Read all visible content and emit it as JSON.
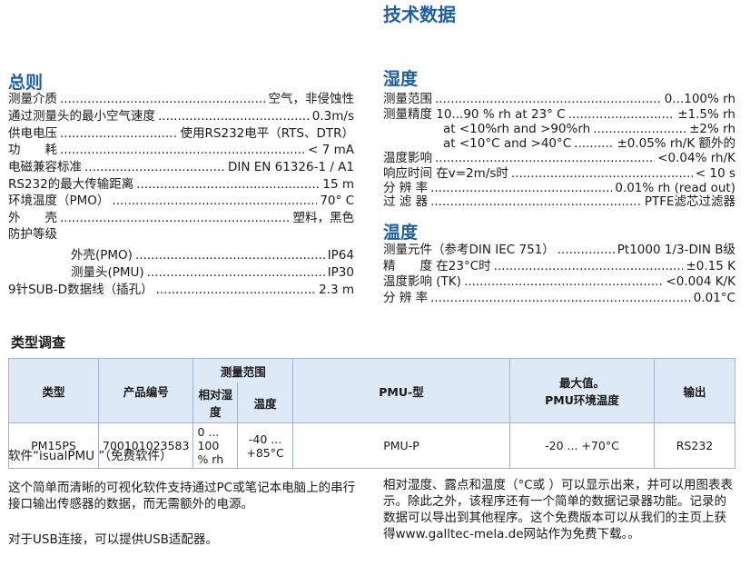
{
  "right_title": "技术数据",
  "left": {
    "heading": "总则",
    "rows": [
      {
        "label": "测量介质",
        "value": "空气，非侵蚀性"
      },
      {
        "label": "通过测量头的最小空气速度",
        "value": "0.3m/s"
      },
      {
        "label": "供电电压",
        "value": "使用RS232电平（RTS、DTR）"
      },
      {
        "label": "功　　耗",
        "value": "< 7 mA"
      },
      {
        "label": "电磁兼容标准",
        "value": "DIN EN 61326-1 / A1"
      },
      {
        "label": "RS232的最大传输距离",
        "value": "15 m"
      },
      {
        "label": "环境温度（PMO）",
        "value": "70° C"
      },
      {
        "label": "外　　壳",
        "value": "塑料，黑色"
      }
    ],
    "protection_title": "防护等级",
    "protection_rows": [
      {
        "label": "外壳(PMO)",
        "value": "IP64"
      },
      {
        "label": "测量头(PMU)",
        "value": "IP30"
      }
    ],
    "cable_row": {
      "label": "9针SUB-D数据线（插孔）",
      "value": "2.3 m"
    }
  },
  "right": {
    "humidity_heading": "湿度",
    "humidity_rows": [
      {
        "label": "测量范围",
        "value": "0...100% rh"
      },
      {
        "label": "测量精度  10...90 % rh at 23° C",
        "value": "±1.5% rh"
      },
      {
        "label": "at <10%rh and >90%rh",
        "value": "±2% rh"
      },
      {
        "label": "at <10°C and >40°C",
        "value": "±0.05% rh/K 额外的"
      },
      {
        "label": "温度影响",
        "value": "<0.04% rh/K"
      },
      {
        "label": "响应时间  在v=2m/s时",
        "value": "< 10 s"
      },
      {
        "label": "分 辨 率",
        "value": "0.01% rh (read out)"
      },
      {
        "label": "过 滤 器",
        "value": "PTFE滤芯过滤器"
      }
    ],
    "temp_heading": "温度",
    "temp_rows": [
      {
        "label": "测量元件（参考DIN IEC 751）",
        "value": "Pt1000 1/3-DIN B级"
      },
      {
        "label": "精　　度  在23°C时",
        "value": "±0.15 K"
      },
      {
        "label": "温度影响 (TK)",
        "value": "<0.004 K/K"
      },
      {
        "label": "分 辨 率",
        "value": "0.01°C"
      }
    ]
  },
  "types": {
    "title": "类型调查",
    "headers": {
      "type": "类型",
      "product_no": "产品编号",
      "range": "测量范围",
      "rh": "相对湿度",
      "temp": "温度",
      "pmu": "PMU-型",
      "max_top": "最大值。",
      "max_bottom": "PMU环境温度",
      "output": "输出"
    },
    "row": [
      "PM15PS",
      "700101023583",
      "0 ... 100 % rh",
      "-40 ... +85°C",
      "PMU-P",
      "-20 ... +70°C",
      "RS232"
    ]
  },
  "software": {
    "title": "软件“isualPMU  ”（免费软件）",
    "left_p1": "这个简单而清晰的可视化软件支持通过PC或笔记本电脑上的串行接口输出传感器的数据，而无需额外的电源。",
    "left_p2": "对于USB连接，可以提供USB适配器。",
    "right_p": "相对湿度、露点和温度（°C或 ）可以显示出来，并可以用图表表示。除此之外，该程序还有一个简单的数据记录器功能。记录的数据可以导出到其他程序。这个免费版本可以从我们的主页上获得www.galltec-mela.de网站作为免费下载。。"
  }
}
